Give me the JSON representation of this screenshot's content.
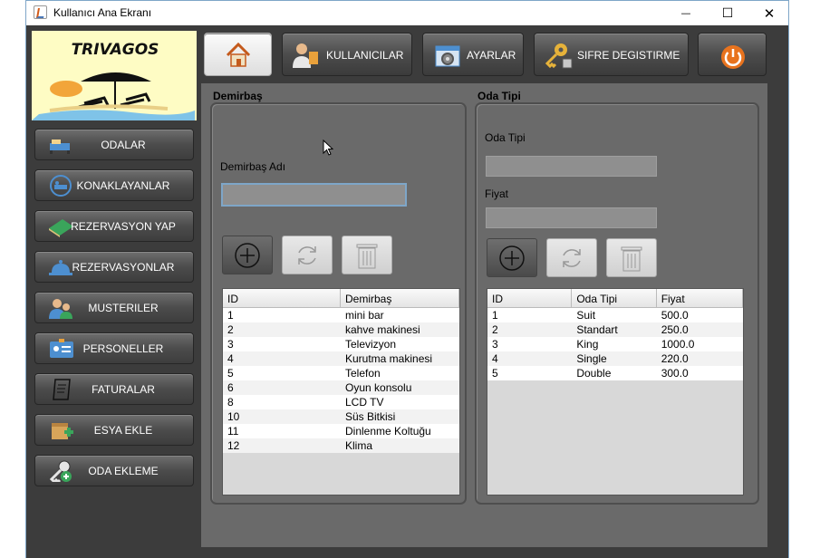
{
  "window": {
    "title": "Kullanıcı Ana Ekranı",
    "minimize": "—",
    "maximize": "☐",
    "close": "✕"
  },
  "logo": {
    "text": "TRIVAGOS"
  },
  "sidebar": {
    "items": [
      {
        "label": "ODALAR",
        "icon": "bed-icon"
      },
      {
        "label": "KONAKLAYANLAR",
        "icon": "guest-bed-icon"
      },
      {
        "label": "REZERVASYON YAP",
        "icon": "book-icon"
      },
      {
        "label": "REZERVASYONLAR",
        "icon": "service-bell-icon"
      },
      {
        "label": "MUSTERILER",
        "icon": "customers-icon"
      },
      {
        "label": "PERSONELLER",
        "icon": "id-card-icon"
      },
      {
        "label": "FATURALAR",
        "icon": "receipt-icon"
      },
      {
        "label": "ESYA EKLE",
        "icon": "box-add-icon"
      },
      {
        "label": "ODA EKLEME",
        "icon": "key-add-icon"
      }
    ]
  },
  "toolbar": {
    "home_icon": "home-icon",
    "users_label": "KULLANICILAR",
    "settings_label": "AYARLAR",
    "password_label": "SIFRE DEGISTIRME",
    "power_icon": "power-icon"
  },
  "demirbas": {
    "section_title": "Demirbaş",
    "field_label": "Demirbaş Adı",
    "field_value": "",
    "columns": [
      "ID",
      "Demirbaş"
    ],
    "rows": [
      [
        "1",
        "mini bar"
      ],
      [
        "2",
        "kahve makinesi"
      ],
      [
        "3",
        "Televizyon"
      ],
      [
        "4",
        "Kurutma makinesi"
      ],
      [
        "5",
        "Telefon"
      ],
      [
        "6",
        "Oyun konsolu"
      ],
      [
        "8",
        "LCD TV"
      ],
      [
        "10",
        "Süs Bitkisi"
      ],
      [
        "11",
        "Dinlenme Koltuğu"
      ],
      [
        "12",
        "Klima"
      ]
    ]
  },
  "odatipi": {
    "section_title": "Oda Tipi",
    "type_label": "Oda Tipi",
    "type_value": "",
    "price_label": "Fiyat",
    "price_value": "",
    "columns": [
      "ID",
      "Oda Tipi",
      "Fiyat"
    ],
    "rows": [
      [
        "1",
        "Suit",
        "500.0"
      ],
      [
        "2",
        "Standart",
        "250.0"
      ],
      [
        "3",
        "King",
        "1000.0"
      ],
      [
        "4",
        "Single",
        "220.0"
      ],
      [
        "5",
        "Double",
        "300.0"
      ]
    ]
  }
}
